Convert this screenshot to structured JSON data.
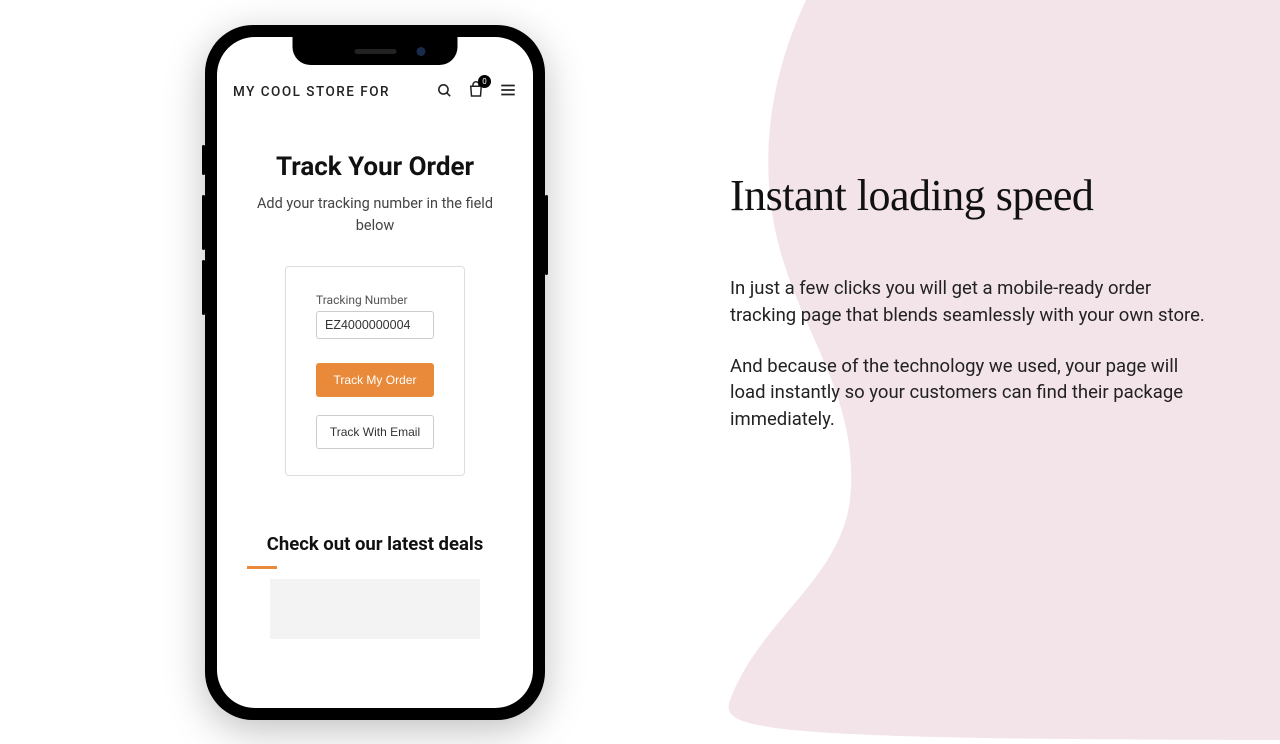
{
  "marketing": {
    "headline": "Instant loading speed",
    "para1": "In just a few clicks you will get a mobile-ready order tracking page that blends seamlessly with your own store.",
    "para2": "And because of the technology we used, your  page will load instantly so your customers can find their package immediately."
  },
  "phone": {
    "store_name": "MY COOL STORE FOR",
    "cart_badge": "0",
    "track_title": "Track Your Order",
    "track_subtitle": "Add your tracking number in the field below",
    "field_label": "Tracking Number",
    "tracking_value": "EZ4000000004",
    "btn_primary": "Track My Order",
    "btn_secondary": "Track With Email",
    "deals_title": "Check out our latest deals"
  },
  "colors": {
    "accent": "#e98a3a",
    "blob": "#f3e4ea"
  }
}
